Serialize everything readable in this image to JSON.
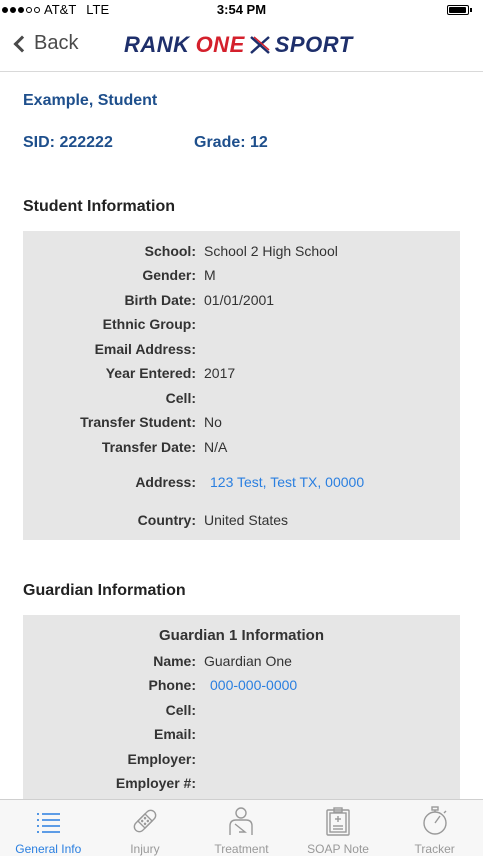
{
  "status_bar": {
    "carrier": "AT&T",
    "network": "LTE",
    "time": "3:54 PM",
    "battery_level": 0.85
  },
  "nav": {
    "back_label": "Back",
    "logo_rank": "RANK",
    "logo_one": "ONE",
    "logo_sport": "SPORT"
  },
  "student": {
    "name": "Example, Student",
    "sid": "SID: 222222",
    "grade": "Grade: 12"
  },
  "student_info": {
    "title": "Student Information",
    "rows": [
      {
        "label": "School:",
        "value": "School 2 High School"
      },
      {
        "label": "Gender:",
        "value": "M"
      },
      {
        "label": "Birth Date:",
        "value": "01/01/2001"
      },
      {
        "label": "Ethnic Group:",
        "value": ""
      },
      {
        "label": "Email Address:",
        "value": ""
      },
      {
        "label": "Year Entered:",
        "value": "2017"
      },
      {
        "label": "Cell:",
        "value": ""
      },
      {
        "label": "Transfer Student:",
        "value": "No"
      },
      {
        "label": "Transfer Date:",
        "value": "N/A"
      },
      {
        "label": "Address:",
        "value": "123 Test, Test TX, 00000"
      },
      {
        "label": "Country:",
        "value": "United States"
      }
    ]
  },
  "guardian_info": {
    "title": "Guardian Information",
    "heading": "Guardian 1 Information",
    "rows": [
      {
        "label": "Name:",
        "value": "Guardian One"
      },
      {
        "label": "Phone:",
        "value": "000-000-0000"
      },
      {
        "label": "Cell:",
        "value": ""
      },
      {
        "label": "Email:",
        "value": ""
      },
      {
        "label": "Employer:",
        "value": ""
      },
      {
        "label": "Employer #:",
        "value": ""
      }
    ]
  },
  "tabs": [
    {
      "label": "General Info",
      "icon": "list-icon",
      "active": true
    },
    {
      "label": "Injury",
      "icon": "bandage-icon",
      "active": false
    },
    {
      "label": "Treatment",
      "icon": "person-sling-icon",
      "active": false
    },
    {
      "label": "SOAP Note",
      "icon": "clipboard-icon",
      "active": false
    },
    {
      "label": "Tracker",
      "icon": "stopwatch-icon",
      "active": false
    }
  ],
  "colors": {
    "accent": "#2a7fe0",
    "brand_navy": "#1e2f6b",
    "brand_red": "#d4202c",
    "box_bg": "#e6e6e6"
  }
}
